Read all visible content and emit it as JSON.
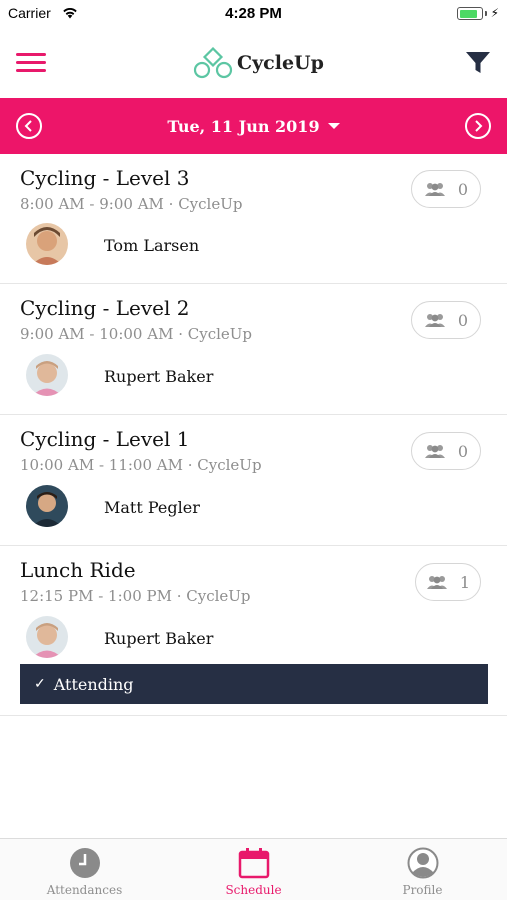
{
  "status_bar": {
    "carrier": "Carrier",
    "time": "4:28 PM",
    "battery_level": 0.85
  },
  "header": {
    "brand": "CycleUp",
    "menu_icon": "hamburger-icon",
    "filter_icon": "filter-icon",
    "accent_color": "#e8196b"
  },
  "date_bar": {
    "date": "Tue, 11 Jun 2019",
    "prev_icon": "chevron-left-circle-icon",
    "next_icon": "chevron-right-circle-icon",
    "background": "#ed1569"
  },
  "classes": [
    {
      "title": "Cycling - Level 3",
      "subtitle": "8:00 AM - 9:00 AM · CycleUp",
      "count": "0",
      "instructor": "Tom Larsen",
      "avatar_color": "#d9a27a"
    },
    {
      "title": "Cycling - Level 2",
      "subtitle": "9:00 AM - 10:00 AM · CycleUp",
      "count": "0",
      "instructor": "Rupert Baker",
      "avatar_color": "#c9a58b"
    },
    {
      "title": "Cycling - Level 1",
      "subtitle": "10:00 AM - 11:00 AM · CycleUp",
      "count": "0",
      "instructor": "Matt Pegler",
      "avatar_color": "#2f4a5c"
    },
    {
      "title": "Lunch Ride",
      "subtitle": "12:15 PM - 1:00 PM · CycleUp",
      "count": "1",
      "instructor": "Rupert Baker",
      "avatar_color": "#c9a58b",
      "attending_label": "Attending"
    }
  ],
  "tabbar": {
    "tabs": [
      {
        "label": "Attendances",
        "icon": "clock-icon",
        "active": false
      },
      {
        "label": "Schedule",
        "icon": "calendar-icon",
        "active": true
      },
      {
        "label": "Profile",
        "icon": "user-icon",
        "active": false
      }
    ]
  }
}
